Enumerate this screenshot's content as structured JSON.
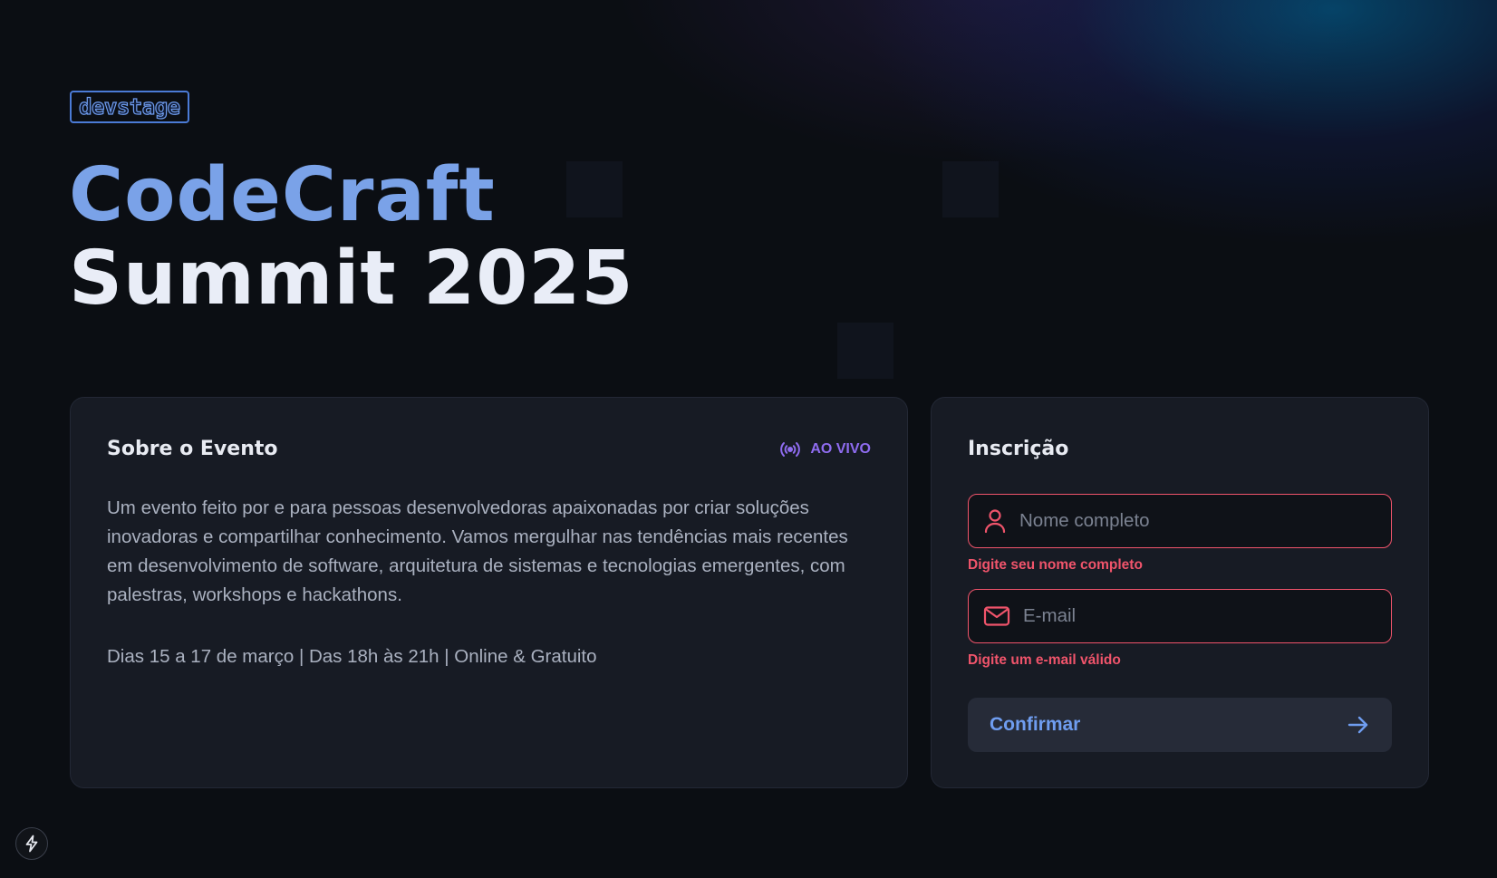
{
  "brand": {
    "logo_text": "devstage"
  },
  "hero": {
    "title_line1": "CodeCraft",
    "title_line2": "Summit 2025"
  },
  "about": {
    "heading": "Sobre o Evento",
    "live_label": "AO VIVO",
    "description": "Um evento feito por e para pessoas desenvolvedoras apaixonadas por criar soluções inovadoras e compartilhar conhecimento. Vamos mergulhar nas tendências mais recentes em desenvolvimento de software, arquitetura de sistemas e tecnologias emergentes, com palestras, workshops e hackathons.",
    "info": "Dias 15 a 17 de março | Das 18h às 21h | Online & Gratuito"
  },
  "signup": {
    "heading": "Inscrição",
    "name_field": {
      "placeholder": "Nome completo",
      "value": "",
      "error": "Digite seu nome completo",
      "icon": "user-icon"
    },
    "email_field": {
      "placeholder": "E-mail",
      "value": "",
      "error": "Digite um e-mail válido",
      "icon": "mail-icon"
    },
    "submit_label": "Confirmar",
    "submit_icon": "arrow-right-icon"
  },
  "dev_tools": {
    "icon": "lightning-icon"
  },
  "colors": {
    "accent": "#7aa2e8",
    "live": "#8f6cf0",
    "error": "#f0546b",
    "background": "#0b0e13",
    "card": "#171b24"
  }
}
